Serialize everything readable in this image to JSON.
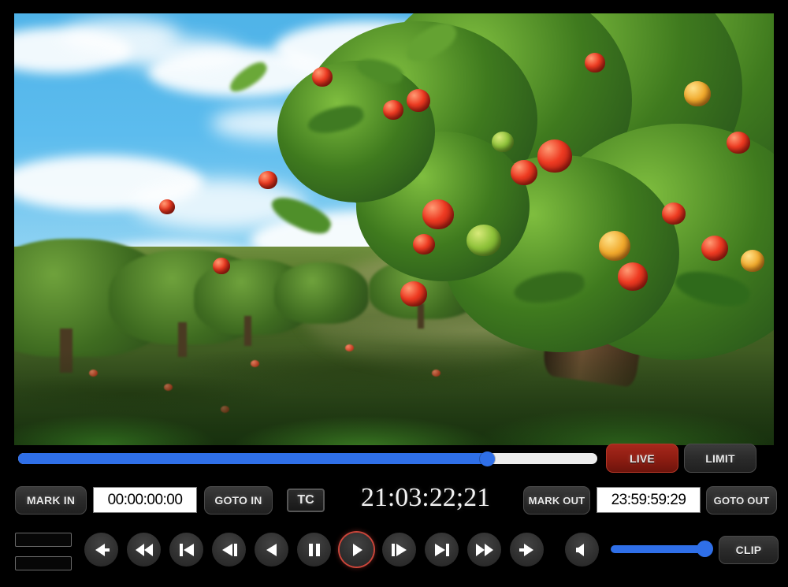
{
  "player": {
    "video": {
      "scene_description": "apple orchard with ripe red apples on tree, blue sky and clouds",
      "alt": "video-preview"
    },
    "scrubber": {
      "name": "timeline-scrubber",
      "position_percent": 81,
      "fill_color": "#2f6fe8",
      "track_color": "#ececec"
    },
    "live_button": {
      "label": "LIVE",
      "active": true,
      "color": "#8f1d12"
    },
    "limit_button": {
      "label": "LIMIT",
      "active": false
    },
    "mark_in_button": {
      "label": "MARK IN"
    },
    "mark_in_field": {
      "value": "00:00:00:00",
      "placeholder": "00:00:00:00"
    },
    "goto_in_button": {
      "label": "GOTO IN"
    },
    "tc_button": {
      "label": "TC"
    },
    "current_timecode": "21:03:22;21",
    "mark_out_button": {
      "label": "MARK OUT"
    },
    "mark_out_field": {
      "value": "23:59:59:29",
      "placeholder": "00:00:00:00"
    },
    "goto_out_button": {
      "label": "GOTO OUT"
    },
    "clip_button": {
      "label": "CLIP"
    },
    "volume": {
      "name": "volume-slider",
      "level_percent": 100,
      "muted": false
    },
    "slots": [
      {
        "value": ""
      },
      {
        "value": ""
      }
    ],
    "transport": [
      {
        "name": "jump-to-start-button",
        "icon": "skip-back-icon",
        "active": false
      },
      {
        "name": "rewind-button",
        "icon": "rewind-icon",
        "active": false
      },
      {
        "name": "previous-clip-button",
        "icon": "previous-track-icon",
        "active": false
      },
      {
        "name": "step-back-button",
        "icon": "step-backward-icon",
        "active": false
      },
      {
        "name": "play-reverse-button",
        "icon": "play-reverse-icon",
        "active": false
      },
      {
        "name": "pause-button",
        "icon": "pause-icon",
        "active": false
      },
      {
        "name": "play-button",
        "icon": "play-icon",
        "active": true
      },
      {
        "name": "step-forward-button",
        "icon": "step-forward-icon",
        "active": false
      },
      {
        "name": "next-clip-button",
        "icon": "next-track-icon",
        "active": false
      },
      {
        "name": "fast-forward-button",
        "icon": "fast-forward-icon",
        "active": false
      },
      {
        "name": "jump-to-end-button",
        "icon": "skip-forward-icon",
        "active": false
      },
      {
        "name": "volume-button",
        "icon": "speaker-icon",
        "active": false
      }
    ]
  }
}
